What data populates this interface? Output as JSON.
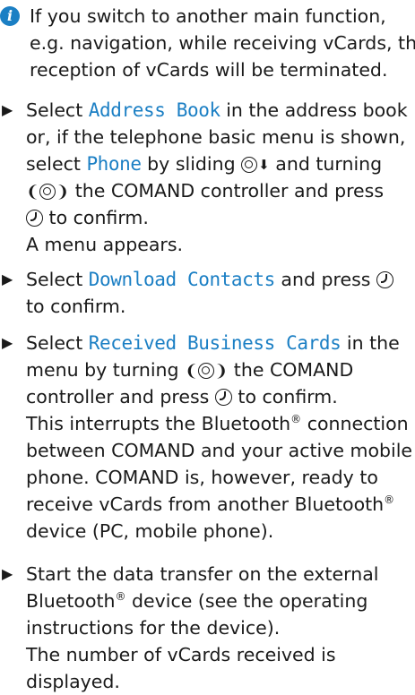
{
  "info": {
    "icon": "info-icon",
    "lines": [
      "If you switch to another main function,",
      "e.g. navigation, while receiving vCards, the",
      "reception of vCards will be terminated."
    ]
  },
  "steps": [
    {
      "line1_pre": "Select ",
      "line1_ui": "Address Book",
      "line1_post": " in the address book",
      "line2": "or, if the telephone basic menu is shown,",
      "line3_pre": "select ",
      "line3_ui": "Phone",
      "line3_post": " by sliding",
      "line3_end": "and turning",
      "line4_post": "the COMAND controller and press",
      "line5_post": "to confirm.",
      "result": "A menu appears."
    },
    {
      "line1_pre": "Select ",
      "line1_ui": "Download Contacts",
      "line1_post": " and press",
      "line2": "to confirm."
    },
    {
      "line1_pre": "Select ",
      "line1_ui": "Received Business Cards",
      "line1_post": " in the",
      "line2_pre": "menu by turning",
      "line2_post": "the COMAND",
      "line3_pre": "controller and press",
      "line3_post": "to confirm.",
      "result_lines": [
        "This interrupts the Bluetooth",
        "connection",
        "between COMAND and your active mobile",
        "phone. COMAND is, however, ready to",
        "receive vCards from another Bluetooth",
        "device (PC, mobile phone)."
      ]
    },
    {
      "line1": "Start the data transfer on the external",
      "line2_pre": "Bluetooth",
      "line2_post": " device (see the operating",
      "line3": "instructions for the device).",
      "result_lines": [
        "The number of vCards received is",
        "displayed."
      ]
    }
  ],
  "symbols": {
    "bullet": "▶",
    "registered": "®",
    "down_arrow": "⬇",
    "bracket_left": "❨",
    "bracket_right": "❩"
  }
}
